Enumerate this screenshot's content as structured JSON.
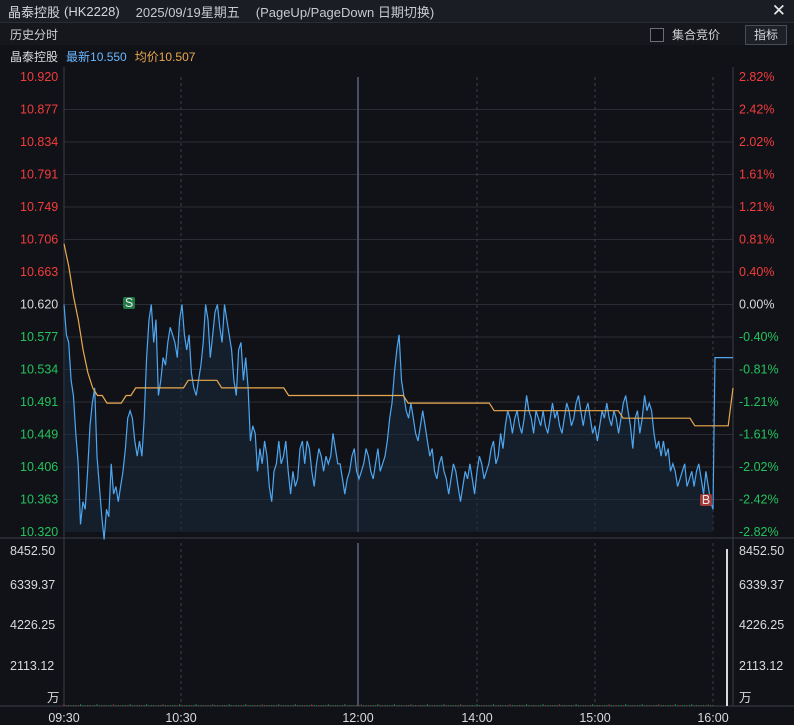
{
  "window": {
    "stock_name": "晶泰控股",
    "code": "(HK2228)",
    "date": "2025/09/19星期五",
    "hint": "(PageUp/PageDown 日期切换)",
    "close_icon": "close-icon"
  },
  "toolbar": {
    "history_label": "历史分时",
    "auction_label": "集合竞价",
    "indicator_label": "指标"
  },
  "legend": {
    "name": "晶泰控股",
    "latest": "最新10.550",
    "avg": "均价10.507"
  },
  "colors": {
    "price_line": "#4ea6f0",
    "avg_line": "#e9a94e",
    "up": "#f23c3c",
    "down": "#22c35e",
    "neutral": "#d8dade",
    "grid": "#2a2d36"
  },
  "markers": {
    "sell": "S",
    "buy": "B"
  },
  "chart_data": {
    "type": "line",
    "prev_close": 10.62,
    "price_ylim": [
      10.32,
      10.92
    ],
    "price_ticks": [
      "10.920",
      "10.877",
      "10.834",
      "10.791",
      "10.749",
      "10.706",
      "10.663",
      "10.620",
      "10.577",
      "10.534",
      "10.491",
      "10.449",
      "10.406",
      "10.363",
      "10.320"
    ],
    "pct_ticks": [
      "2.82%",
      "2.42%",
      "2.02%",
      "1.61%",
      "1.21%",
      "0.81%",
      "0.40%",
      "0.00%",
      "-0.40%",
      "-0.81%",
      "-1.21%",
      "-1.61%",
      "-2.02%",
      "-2.42%",
      "-2.82%"
    ],
    "x_ticks": [
      "09:30",
      "10:30",
      "12:00",
      "14:00",
      "15:00",
      "16:00"
    ],
    "volume_ticks": [
      "8452.50",
      "6339.37",
      "4226.25",
      "2113.12"
    ],
    "volume_unit": "万",
    "volume_ylim": [
      0,
      8452.5
    ],
    "series": [
      {
        "values": [
          10.62,
          10.58,
          10.57,
          10.52,
          10.5,
          10.45,
          10.41,
          10.33,
          10.36,
          10.35,
          10.4,
          10.46,
          10.49,
          10.51,
          10.42,
          10.38,
          10.34,
          10.31,
          10.35,
          10.34,
          10.41,
          10.37,
          10.38,
          10.36,
          10.38,
          10.4,
          10.43,
          10.47,
          10.48,
          10.47,
          10.44,
          10.42,
          10.44,
          10.42,
          10.47,
          10.55,
          10.6,
          10.62,
          10.57,
          10.6,
          10.5,
          10.52,
          10.55,
          10.54,
          10.57,
          10.59,
          10.58,
          10.57,
          10.55,
          10.6,
          10.62,
          10.58,
          10.56,
          10.58,
          10.53,
          10.51,
          10.5,
          10.52,
          10.54,
          10.57,
          10.62,
          10.6,
          10.55,
          10.58,
          10.61,
          10.62,
          10.59,
          10.57,
          10.62,
          10.6,
          10.58,
          10.56,
          10.52,
          10.5,
          10.56,
          10.57,
          10.52,
          10.55,
          10.51,
          10.44,
          10.46,
          10.45,
          10.4,
          10.43,
          10.41,
          10.44,
          10.42,
          10.38,
          10.36,
          10.4,
          10.41,
          10.44,
          10.41,
          10.42,
          10.44,
          10.4,
          10.37,
          10.4,
          10.38,
          10.39,
          10.43,
          10.44,
          10.41,
          10.44,
          10.43,
          10.4,
          10.38,
          10.41,
          10.43,
          10.42,
          10.4,
          10.42,
          10.41,
          10.42,
          10.45,
          10.43,
          10.41,
          10.41,
          10.39,
          10.37,
          10.39,
          10.4,
          10.42,
          10.43,
          10.4,
          10.39,
          10.4,
          10.41,
          10.43,
          10.42,
          10.4,
          10.39,
          10.41,
          10.43,
          10.4,
          10.41,
          10.42,
          10.44,
          10.47,
          10.49,
          10.53,
          10.56,
          10.58,
          10.52,
          10.5,
          10.48,
          10.47,
          10.49,
          10.47,
          10.45,
          10.44,
          10.46,
          10.48,
          10.46,
          10.44,
          10.42,
          10.43,
          10.4,
          10.39,
          10.41,
          10.42,
          10.4,
          10.39,
          10.37,
          10.39,
          10.41,
          10.4,
          10.38,
          10.36,
          10.38,
          10.4,
          10.39,
          10.41,
          10.39,
          10.37,
          10.4,
          10.42,
          10.41,
          10.39,
          10.4,
          10.41,
          10.43,
          10.44,
          10.41,
          10.42,
          10.45,
          10.43,
          10.46,
          10.48,
          10.47,
          10.45,
          10.47,
          10.48,
          10.46,
          10.45,
          10.47,
          10.5,
          10.48,
          10.47,
          10.45,
          10.48,
          10.47,
          10.46,
          10.48,
          10.46,
          10.45,
          10.47,
          10.49,
          10.47,
          10.48,
          10.46,
          10.45,
          10.47,
          10.49,
          10.48,
          10.46,
          10.47,
          10.49,
          10.5,
          10.48,
          10.46,
          10.48,
          10.49,
          10.47,
          10.45,
          10.46,
          10.44,
          10.46,
          10.48,
          10.47,
          10.49,
          10.47,
          10.46,
          10.48,
          10.47,
          10.45,
          10.47,
          10.49,
          10.5,
          10.48,
          10.46,
          10.43,
          10.47,
          10.48,
          10.45,
          10.47,
          10.5,
          10.48,
          10.49,
          10.48,
          10.45,
          10.43,
          10.44,
          10.42,
          10.44,
          10.42,
          10.43,
          10.4,
          10.41,
          10.4,
          10.38,
          10.39,
          10.4,
          10.41,
          10.38,
          10.39,
          10.4,
          10.38,
          10.4,
          10.41,
          10.39,
          10.37,
          10.4,
          10.38,
          10.36,
          10.35
        ],
        "close_value": 10.55
      },
      {
        "name": "均价",
        "values": [
          10.7,
          10.67,
          10.63,
          10.6,
          10.56,
          10.53,
          10.51,
          10.5,
          10.5,
          10.49,
          10.49,
          10.49,
          10.49,
          10.5,
          10.5,
          10.51,
          10.51,
          10.51,
          10.51,
          10.51,
          10.51,
          10.51,
          10.51,
          10.51,
          10.51,
          10.51,
          10.52,
          10.52,
          10.52,
          10.52,
          10.52,
          10.52,
          10.52,
          10.51,
          10.51,
          10.51,
          10.51,
          10.51,
          10.51,
          10.51,
          10.51,
          10.51,
          10.51,
          10.51,
          10.51,
          10.51,
          10.51,
          10.5,
          10.5,
          10.5,
          10.5,
          10.5,
          10.5,
          10.5,
          10.5,
          10.5,
          10.5,
          10.5,
          10.5,
          10.5,
          10.5,
          10.5,
          10.5,
          10.5,
          10.5,
          10.5,
          10.5,
          10.5,
          10.5,
          10.5,
          10.5,
          10.5,
          10.49,
          10.49,
          10.49,
          10.49,
          10.49,
          10.49,
          10.49,
          10.49,
          10.49,
          10.49,
          10.49,
          10.49,
          10.49,
          10.49,
          10.49,
          10.49,
          10.49,
          10.49,
          10.48,
          10.48,
          10.48,
          10.48,
          10.48,
          10.48,
          10.48,
          10.48,
          10.48,
          10.48,
          10.48,
          10.48,
          10.48,
          10.48,
          10.48,
          10.48,
          10.48,
          10.48,
          10.48,
          10.48,
          10.48,
          10.48,
          10.48,
          10.48,
          10.48,
          10.48,
          10.48,
          10.47,
          10.47,
          10.47,
          10.47,
          10.47,
          10.47,
          10.47,
          10.47,
          10.47,
          10.47,
          10.47,
          10.47,
          10.47,
          10.47,
          10.47,
          10.46,
          10.46,
          10.46,
          10.46,
          10.46,
          10.46,
          10.46,
          10.46,
          10.51
        ]
      }
    ]
  }
}
